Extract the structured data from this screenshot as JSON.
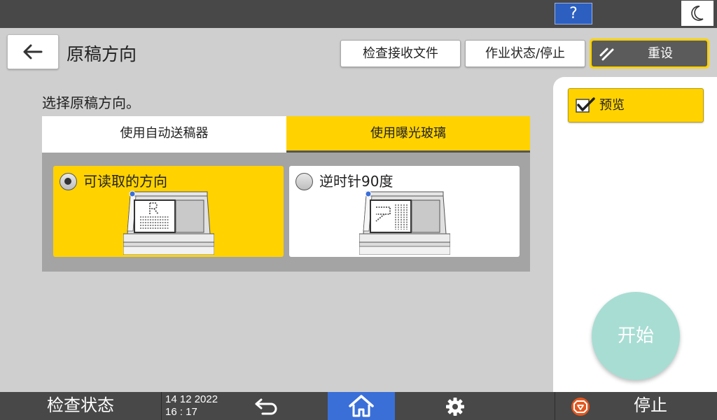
{
  "topbar": {
    "help_label": "?",
    "help_color": "#2c5fc0",
    "night_mode_icon": "moon-icon"
  },
  "header": {
    "back_icon": "arrow-left-icon",
    "title": "原稿方向",
    "check_received_label": "检查接收文件",
    "job_status_label": "作业状态/停止",
    "reset_label": "重设",
    "reset_icon": "double-slash-icon",
    "accent_color": "#ffd200"
  },
  "main": {
    "instruction": "选择原稿方向。",
    "tabs": [
      {
        "label": "使用自动送稿器",
        "selected": false
      },
      {
        "label": "使用曝光玻璃",
        "selected": true
      }
    ],
    "options": [
      {
        "label": "可读取的方向",
        "selected": true,
        "icon": "scanner-readable-icon"
      },
      {
        "label": "逆时针90度",
        "selected": false,
        "icon": "scanner-rotated-icon"
      }
    ]
  },
  "right": {
    "preview_label": "预览",
    "preview_checked": true,
    "start_label": "开始",
    "start_color": "#a8ddd3"
  },
  "bottom": {
    "check_status_label": "检查状态",
    "date": "14 12 2022",
    "time": "16 : 17",
    "back_icon": "return-arrow-icon",
    "home_icon": "home-icon",
    "home_color": "#3a6fd8",
    "settings_icon": "gear-icon",
    "stop_label": "停止",
    "stop_icon": "stop-icon"
  }
}
